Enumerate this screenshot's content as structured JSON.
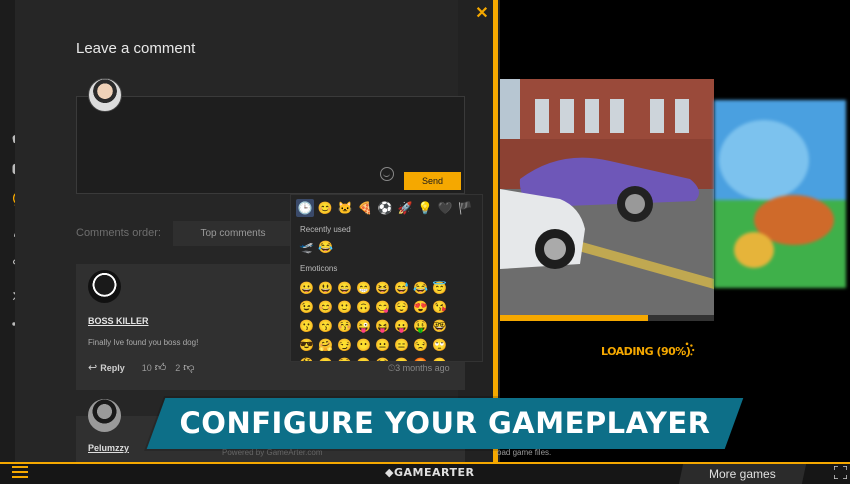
{
  "panel": {
    "title": "Leave a comment",
    "close_icon": "close-icon",
    "send_label": "Send",
    "order_label": "Comments order:",
    "order_value": "Top comments",
    "powered_by": "Powered by GameArter.com"
  },
  "sidebar": {
    "icons": [
      "gamepad-icon",
      "youtube-icon",
      "comment-icon",
      "user-icon",
      "share-icon",
      "rocket-icon",
      "more-icon"
    ]
  },
  "comments": [
    {
      "name": "BOSS KILLER",
      "text": "Finally Ive found you boss dog!",
      "reply": "Reply",
      "likes": "10",
      "dislikes": "2",
      "time": "3 months ago"
    },
    {
      "name": "Pelumzzy"
    }
  ],
  "emoji": {
    "recently_label": "Recently used",
    "emoticons_label": "Emoticons",
    "tabs": [
      "🕒",
      "😊",
      "🐱",
      "🍕",
      "⚽",
      "🚀",
      "💡",
      "🖤",
      "🏴"
    ],
    "recent": [
      "🛫",
      "😂"
    ],
    "grid": [
      "😀",
      "😃",
      "😄",
      "😁",
      "😆",
      "😅",
      "😂",
      "😇",
      "😉",
      "😊",
      "🙂",
      "🙃",
      "😋",
      "😌",
      "😍",
      "😘",
      "😗",
      "😙",
      "😚",
      "😜",
      "😝",
      "😛",
      "🤑",
      "🤓",
      "😎",
      "🤗",
      "😏",
      "😶",
      "😐",
      "😑",
      "😒",
      "🙄",
      "🤔",
      "😬",
      "😳",
      "😞",
      "😟",
      "😠",
      "😡",
      "😔",
      "😕",
      "🙁"
    ]
  },
  "loading": {
    "text": "LOADING (90%)",
    "progress_fraction": 0.69
  },
  "banner": {
    "text": "CONFIGURE YOUR GAMEPLAYER"
  },
  "download_note": "oad game files.",
  "bottom": {
    "brand": "◆GAMEARTER",
    "more_games": "More games"
  },
  "colors": {
    "accent": "#f5a800",
    "banner": "#0d6f88"
  }
}
